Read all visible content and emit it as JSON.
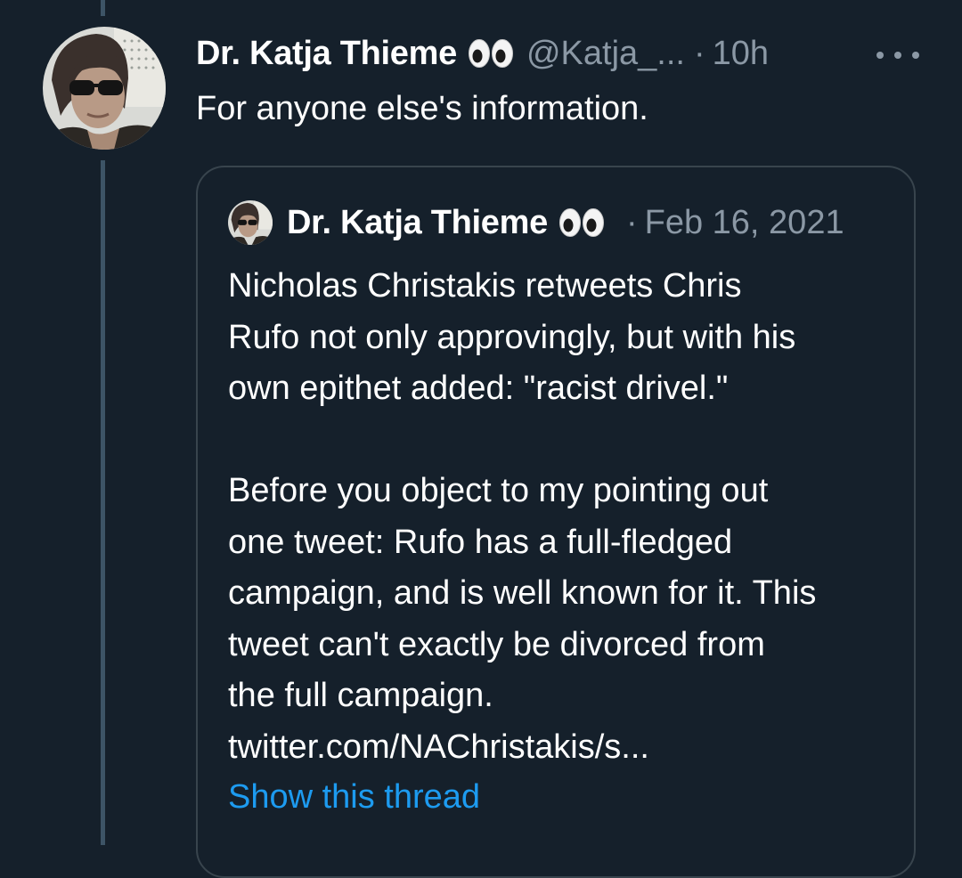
{
  "tweet": {
    "author_name": "Dr. Katja Thieme",
    "author_emoji_icon": "eyes-emoji-icon",
    "handle": "@Katja_...",
    "separator": "·",
    "time": "10h",
    "text": "For anyone else's information."
  },
  "quoted_tweet": {
    "author_name": "Dr. Katja Thieme",
    "author_emoji_icon": "eyes-emoji-icon",
    "separator": "·",
    "date": "Feb 16, 2021",
    "paragraph1": [
      "Nicholas Christakis retweets Chris",
      "Rufo not only approvingly, but with his",
      "own epithet added: \"racist drivel.\""
    ],
    "paragraph2": [
      "Before you object to my pointing out",
      "one tweet: Rufo has a full-fledged",
      "campaign, and is well known for it. This",
      "tweet can't exactly be divorced from",
      "the full campaign."
    ],
    "link": "twitter.com/NAChristakis/s...",
    "show_thread_label": "Show this thread"
  },
  "colors": {
    "background": "#15202b",
    "text_primary": "#ffffff",
    "text_secondary": "#8b98a5",
    "link": "#1d9bf0",
    "card_border": "#38444d",
    "thread_line": "#3d5466"
  }
}
